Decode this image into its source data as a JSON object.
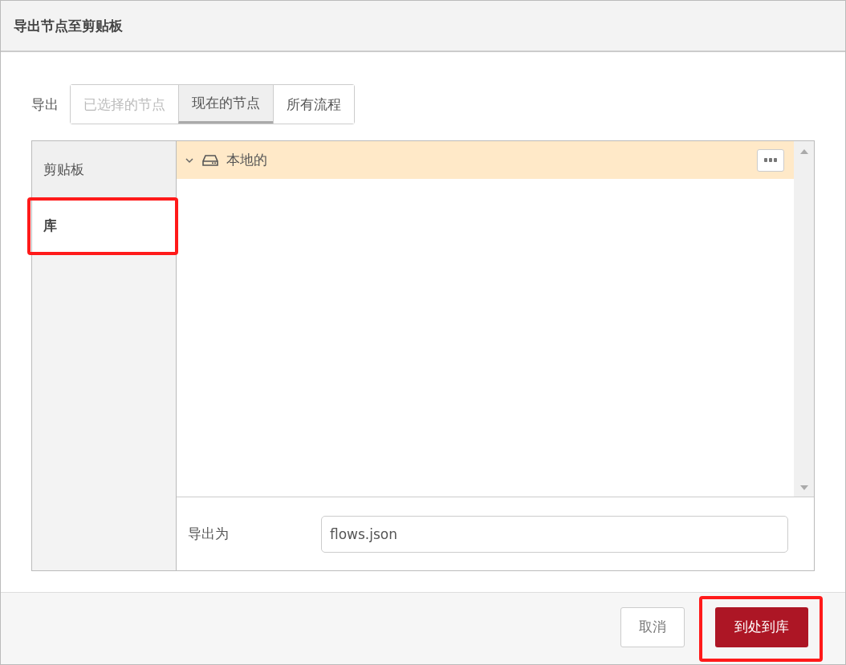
{
  "dialog": {
    "title": "导出节点至剪贴板"
  },
  "export": {
    "label": "导出",
    "options": [
      {
        "label": "已选择的节点",
        "selected": false,
        "disabled": true
      },
      {
        "label": "现在的节点",
        "selected": true,
        "disabled": false
      },
      {
        "label": "所有流程",
        "selected": false,
        "disabled": false
      }
    ]
  },
  "tabs": [
    {
      "label": "剪贴板",
      "selected": false,
      "highlighted": false
    },
    {
      "label": "库",
      "selected": true,
      "highlighted": true
    }
  ],
  "tree": {
    "items": [
      {
        "label": "本地的",
        "expanded": true,
        "selected": true
      }
    ]
  },
  "filename": {
    "label": "导出为",
    "value": "flows.json"
  },
  "buttons": [
    {
      "label": "取消",
      "kind": "secondary",
      "highlighted": false
    },
    {
      "label": "到处到库",
      "kind": "primary",
      "highlighted": true
    }
  ]
}
